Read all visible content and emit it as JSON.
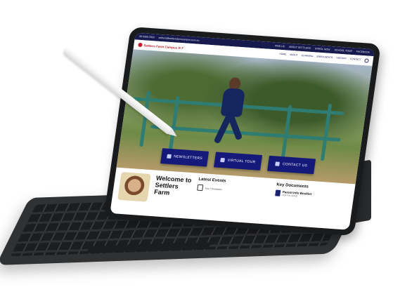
{
  "util_bar": {
    "phone": "08 9300 2020",
    "email": "settlers@settlersfarmcampus.com.au",
    "links": [
      "FIND US",
      "ABOUT SETTLERS",
      "ENROL NOW",
      "SCHOOL TOUR",
      "FACEBOOK"
    ]
  },
  "nav": {
    "logo_text": "Settlers Farm Campus R-7",
    "links": [
      "HOME",
      "ABOUT",
      "LEARNING",
      "ENROLMENTS",
      "HISTORY",
      "CONTACT"
    ]
  },
  "cta": {
    "newsletters": "NEWSLETTERS",
    "virtual_tour": "VIRTUAL TOUR",
    "contact_us": "CONTACT US"
  },
  "content": {
    "welcome_heading": "Welcome to Settlers Farm",
    "latest_events_title": "Latest Events",
    "event_item": "Year 7 Graduation",
    "key_documents_title": "Key Documents",
    "doc_title": "Parent Info Booklet",
    "doc_meta": "PDF File 420KB"
  },
  "colors": {
    "brand_navy": "#151a7a",
    "util_bar": "#161a4d",
    "brand_red": "#c21b2f"
  }
}
